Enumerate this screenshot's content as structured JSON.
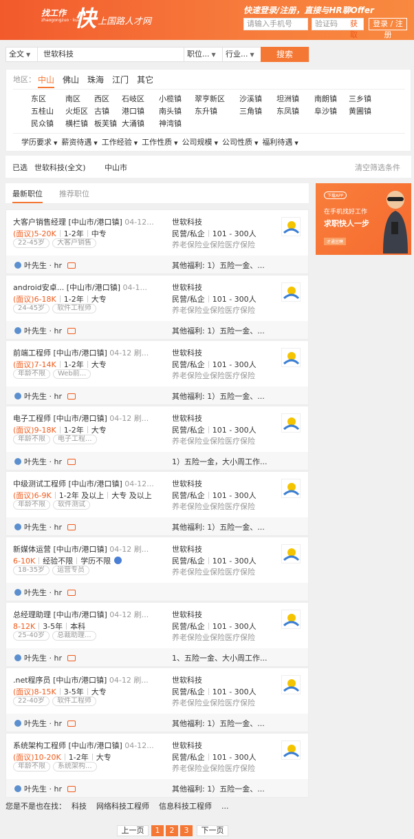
{
  "header": {
    "logo_small": "找工作",
    "logo_big": "快",
    "logo_sub": "上国路人才网",
    "logo_tag": "zhaogongzuo · kuai",
    "promo": "快速登录/注册，直接与HR聊Offer",
    "phone_placeholder": "请输入手机号",
    "code_placeholder": "验证码",
    "get_code": "获取",
    "login": "登录 / 注册"
  },
  "search": {
    "scope": "全文",
    "keyword": "世软科技",
    "position": "职位...",
    "industry": "行业...",
    "button": "搜索"
  },
  "filter": {
    "region_label": "地区：",
    "regions": [
      "中山",
      "佛山",
      "珠海",
      "江门",
      "其它"
    ],
    "districts": [
      [
        "东区",
        "南区",
        "西区",
        "石岐区",
        "小榄镇",
        "翠亨新区",
        "沙溪镇",
        "坦洲镇",
        "南朗镇",
        "三乡镇"
      ],
      [
        "五桂山",
        "火炬区",
        "古镇",
        "港口镇",
        "南头镇",
        "东升镇",
        "三角镇",
        "东凤镇",
        "阜沙镇",
        "黄圃镇"
      ],
      [
        "民众镇",
        "横栏镇",
        "板芙镇",
        "大涌镇",
        "神湾镇"
      ]
    ],
    "criteria": [
      "学历要求",
      "薪资待遇",
      "工作经验",
      "工作性质",
      "公司规模",
      "公司性质",
      "福利待遇"
    ]
  },
  "selected": {
    "label": "已选",
    "items": [
      "世软科技(全文)",
      "中山市"
    ],
    "clear": "清空筛选条件"
  },
  "tabs": [
    "最新职位",
    "推荐职位"
  ],
  "ad": {
    "badge": "下载APP",
    "line1": "在手机找好工作",
    "line2": "求职快人一步",
    "btn": "才通宜聘"
  },
  "jobs": [
    {
      "title": "大客户销售经理",
      "loc": "[中山市/港口镇]",
      "date": "04-12...",
      "salary": "(面议)5-20K",
      "exp": "1-2年",
      "edu": "中专",
      "tags": [
        "22-45岁",
        "大客户销售"
      ],
      "company": "世软科技",
      "ctype": "民营/私企",
      "size": "101 - 300人",
      "benefits": "养老保险业保险医疗保险",
      "hr": "叶先生 · hr",
      "welfare": "其他福利: 1）五险一金、..."
    },
    {
      "title": "android安卓...",
      "loc": "[中山市/港口镇]",
      "date": "04-1...",
      "salary": "(面议)6-18K",
      "exp": "1-2年",
      "edu": "大专",
      "tags": [
        "24-45岁",
        "软件工程师"
      ],
      "company": "世软科技",
      "ctype": "民营/私企",
      "size": "101 - 300人",
      "benefits": "养老保险业保险医疗保险",
      "hr": "叶先生 · hr",
      "welfare": "其他福利: 1）五险一金、..."
    },
    {
      "title": "前端工程师",
      "loc": "[中山市/港口镇]",
      "date": "04-12 刷...",
      "salary": "(面议)7-14K",
      "exp": "1-2年",
      "edu": "大专",
      "tags": [
        "年龄不限",
        "Web前..."
      ],
      "company": "世软科技",
      "ctype": "民营/私企",
      "size": "101 - 300人",
      "benefits": "养老保险业保险医疗保险",
      "hr": "叶先生 · hr",
      "welfare": "其他福利: 1）五险一金、..."
    },
    {
      "title": "电子工程师",
      "loc": "[中山市/港口镇]",
      "date": "04-12 刷...",
      "salary": "(面议)9-18K",
      "exp": "1-2年",
      "edu": "大专",
      "tags": [
        "年龄不限",
        "电子工程..."
      ],
      "company": "世软科技",
      "ctype": "民营/私企",
      "size": "101 - 300人",
      "benefits": "养老保险业保险医疗保险",
      "hr": "叶先生 · hr",
      "welfare": "1）五险一金，大小周工作..."
    },
    {
      "title": "中级测试工程师",
      "loc": "[中山市/港口镇]",
      "date": "04-12...",
      "salary": "(面议)6-9K",
      "exp": "1-2年 及以上",
      "edu": "大专 及以上",
      "tags": [
        "年龄不限",
        "软件测试"
      ],
      "company": "世软科技",
      "ctype": "民营/私企",
      "size": "101 - 300人",
      "benefits": "养老保险业保险医疗保险",
      "hr": "叶先生 · hr",
      "welfare": "其他福利: 1）五险一金、..."
    },
    {
      "title": "新媒体运营",
      "loc": "[中山市/港口镇]",
      "date": "04-12 刷...",
      "salary": "6-10K",
      "exp": "经验不限",
      "edu": "学历不限",
      "tags": [
        "18-35岁",
        "运营专员"
      ],
      "company": "世软科技",
      "ctype": "民营/私企",
      "size": "101 - 300人",
      "benefits": "养老保险业保险医疗保险",
      "hr": "叶先生 · hr",
      "welfare": ""
    },
    {
      "title": "总经理助理",
      "loc": "[中山市/港口镇]",
      "date": "04-12 刷...",
      "salary": "8-12K",
      "exp": "3-5年",
      "edu": "本科",
      "tags": [
        "25-40岁",
        "总裁助理..."
      ],
      "company": "世软科技",
      "ctype": "民营/私企",
      "size": "101 - 300人",
      "benefits": "养老保险业保险医疗保险",
      "hr": "叶先生 · hr",
      "welfare": "1、五险一金、大小周工作..."
    },
    {
      "title": ".net程序员",
      "loc": "[中山市/港口镇]",
      "date": "04-12 刷...",
      "salary": "(面议)8-15K",
      "exp": "3-5年",
      "edu": "大专",
      "tags": [
        "22-40岁",
        "软件工程师"
      ],
      "company": "世软科技",
      "ctype": "民营/私企",
      "size": "101 - 300人",
      "benefits": "养老保险业保险医疗保险",
      "hr": "叶先生 · hr",
      "welfare": "其他福利: 1）五险一金、..."
    },
    {
      "title": "系统架构工程师",
      "loc": "[中山市/港口镇]",
      "date": "04-12...",
      "salary": "(面议)10-20K",
      "exp": "1-2年",
      "edu": "大专",
      "tags": [
        "年龄不限",
        "系统架构..."
      ],
      "company": "世软科技",
      "ctype": "民营/私企",
      "size": "101 - 300人",
      "benefits": "养老保险业保险医疗保险",
      "hr": "叶先生 · hr",
      "welfare": "其他福利: 1）五险一金、..."
    }
  ],
  "related": {
    "label": "您是不是也在找：",
    "items": [
      "科技",
      "网络科技工程师",
      "信息科技工程师",
      "..."
    ]
  },
  "pager": {
    "prev": "上一页",
    "pages": [
      "1",
      "2",
      "3"
    ],
    "next": "下一页"
  },
  "colors": {
    "orange": "#f47733",
    "salary": "#f05a1a"
  }
}
